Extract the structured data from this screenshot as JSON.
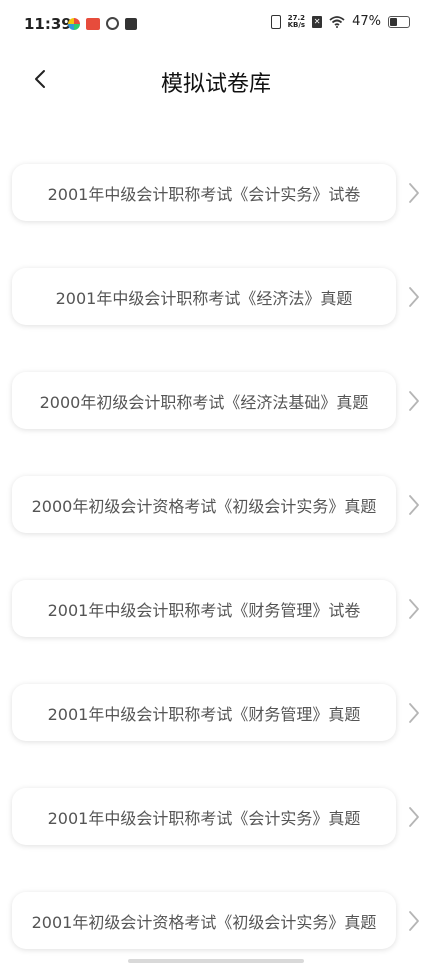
{
  "status_bar": {
    "time": "11:39",
    "net_speed_value": "27.2",
    "net_speed_unit": "KB/s",
    "battery": "47%"
  },
  "header": {
    "title": "模拟试卷库"
  },
  "papers": [
    {
      "label": "2001年中级会计职称考试《会计实务》试卷"
    },
    {
      "label": "2001年中级会计职称考试《经济法》真题"
    },
    {
      "label": "2000年初级会计职称考试《经济法基础》真题"
    },
    {
      "label": "2000年初级会计资格考试《初级会计实务》真题"
    },
    {
      "label": "2001年中级会计职称考试《财务管理》试卷"
    },
    {
      "label": "2001年中级会计职称考试《财务管理》真题"
    },
    {
      "label": "2001年中级会计职称考试《会计实务》真题"
    },
    {
      "label": "2001年初级会计资格考试《初级会计实务》真题"
    }
  ],
  "icons": {
    "back": "chevron-left-icon",
    "item_arrow": "chevron-right-icon"
  }
}
